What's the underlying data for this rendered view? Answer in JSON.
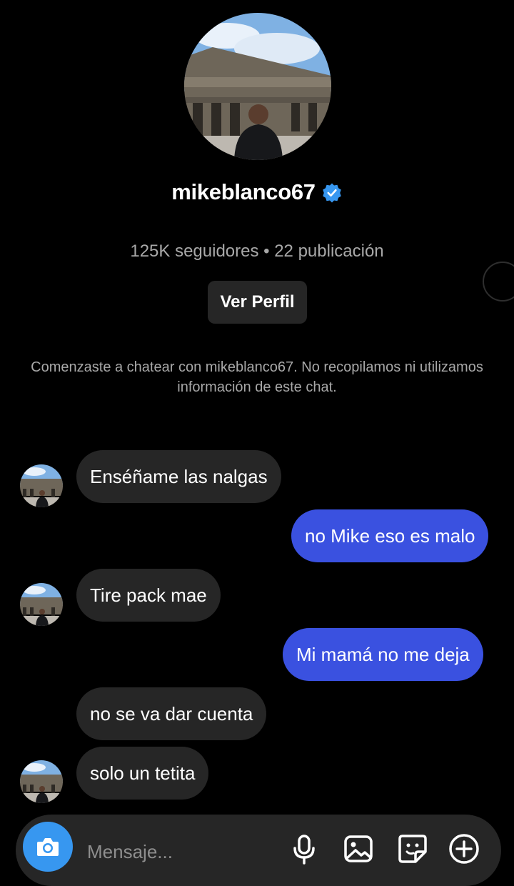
{
  "header": {
    "username": "mikeblanco67",
    "stats": "125K seguidores • 22 publicación",
    "view_profile_label": "Ver Perfil",
    "notice": "Comenzaste a chatear con mikeblanco67. No recopilamos ni utilizamos información de este chat."
  },
  "messages": [
    {
      "direction": "incoming",
      "text": "Enséñame las nalgas"
    },
    {
      "direction": "outgoing",
      "text": "no Mike eso es malo"
    },
    {
      "direction": "incoming",
      "text": "Tire pack mae"
    },
    {
      "direction": "outgoing",
      "text": "Mi mamá no me deja"
    },
    {
      "direction": "incoming",
      "text": "no se va dar cuenta"
    },
    {
      "direction": "incoming",
      "text": "solo un tetita"
    }
  ],
  "composer": {
    "placeholder": "Mensaje..."
  },
  "colors": {
    "background": "#000000",
    "incoming_bubble": "#262626",
    "outgoing_bubble": "#3a51e0",
    "camera_button": "#3797f0",
    "verified_badge": "#3797f0"
  },
  "icons": [
    "verified-badge-icon",
    "camera-icon",
    "microphone-icon",
    "gallery-icon",
    "sticker-icon",
    "plus-icon"
  ]
}
